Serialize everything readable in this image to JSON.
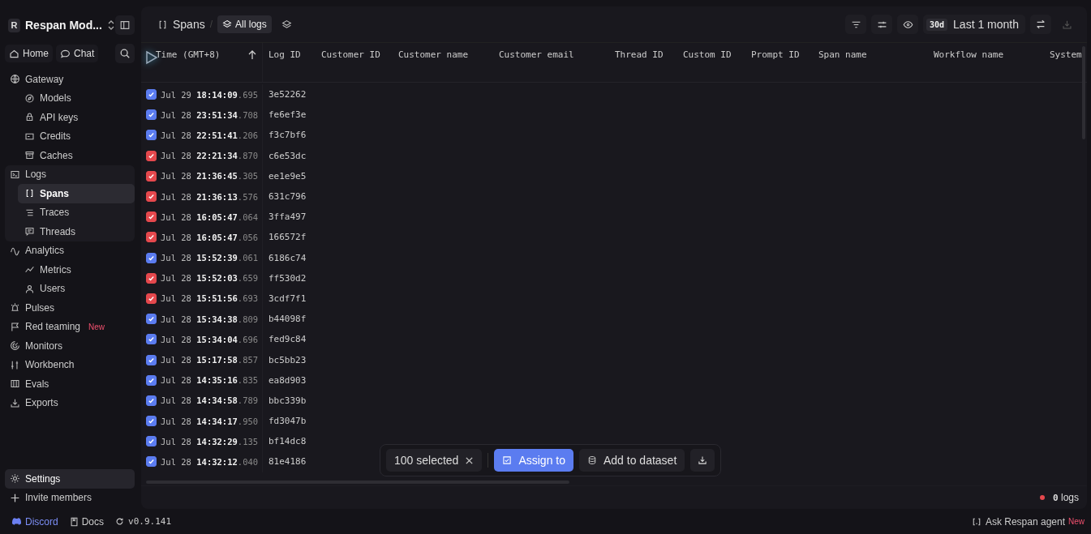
{
  "workspace": {
    "initial": "R",
    "name": "Respan Mod..."
  },
  "quick_links": [
    {
      "label": "Home"
    },
    {
      "label": "Chat"
    }
  ],
  "nav": [
    {
      "label": "Gateway",
      "selected": false,
      "children": [
        {
          "label": "Models",
          "selected": false
        },
        {
          "label": "API keys",
          "selected": false
        },
        {
          "label": "Credits",
          "selected": false
        },
        {
          "label": "Caches",
          "selected": false
        }
      ]
    },
    {
      "label": "Logs",
      "selected": false,
      "children": [
        {
          "label": "Spans",
          "selected": true
        },
        {
          "label": "Traces",
          "selected": false
        },
        {
          "label": "Threads",
          "selected": false
        }
      ]
    },
    {
      "label": "Analytics",
      "selected": false,
      "children": [
        {
          "label": "Metrics",
          "selected": false
        },
        {
          "label": "Users",
          "selected": false
        }
      ]
    },
    {
      "label": "Pulses",
      "selected": false
    },
    {
      "label": "Red teaming",
      "selected": false,
      "badge": "New"
    },
    {
      "label": "Monitors",
      "selected": false
    },
    {
      "label": "Workbench",
      "selected": false
    },
    {
      "label": "Evals",
      "selected": false
    },
    {
      "label": "Exports",
      "selected": false
    }
  ],
  "bottom_nav": [
    {
      "label": "Settings",
      "selected": true
    },
    {
      "label": "Invite members",
      "selected": false
    }
  ],
  "footer": {
    "links": [
      {
        "label": "Discord"
      },
      {
        "label": "Docs"
      }
    ],
    "version": "v0.9.141",
    "agent": "Ask Respan agent",
    "agent_badge": "New"
  },
  "breadcrumb": {
    "page": "Spans",
    "separator": "/",
    "view": "All logs"
  },
  "toolbar": {
    "range_badge": "30d",
    "range": "Last 1 month"
  },
  "table": {
    "columns": [
      "Time (GMT+8)",
      "Log ID",
      "Customer ID",
      "Customer name",
      "Customer email",
      "Thread ID",
      "Custom ID",
      "Prompt ID",
      "Span name",
      "Workflow name",
      "System"
    ],
    "rows": [
      {
        "checked": true,
        "color": "#5b7cf0",
        "date": "Jul 29",
        "time": "18:14:09",
        "ms": ".695",
        "log_id": "3e52262"
      },
      {
        "checked": true,
        "color": "#5b7cf0",
        "date": "Jul 28",
        "time": "23:51:34",
        "ms": ".708",
        "log_id": "fe6ef3e"
      },
      {
        "checked": true,
        "color": "#5b7cf0",
        "date": "Jul 28",
        "time": "22:51:41",
        "ms": ".206",
        "log_id": "f3c7bf6"
      },
      {
        "checked": true,
        "color": "#e5484d",
        "date": "Jul 28",
        "time": "22:21:34",
        "ms": ".870",
        "log_id": "c6e53dc"
      },
      {
        "checked": true,
        "color": "#e5484d",
        "date": "Jul 28",
        "time": "21:36:45",
        "ms": ".305",
        "log_id": "ee1e9e5"
      },
      {
        "checked": true,
        "color": "#e5484d",
        "date": "Jul 28",
        "time": "21:36:13",
        "ms": ".576",
        "log_id": "631c796"
      },
      {
        "checked": true,
        "color": "#e5484d",
        "date": "Jul 28",
        "time": "16:05:47",
        "ms": ".064",
        "log_id": "3ffa497"
      },
      {
        "checked": true,
        "color": "#e5484d",
        "date": "Jul 28",
        "time": "16:05:47",
        "ms": ".056",
        "log_id": "166572f"
      },
      {
        "checked": true,
        "color": "#5b7cf0",
        "date": "Jul 28",
        "time": "15:52:39",
        "ms": ".061",
        "log_id": "6186c74"
      },
      {
        "checked": true,
        "color": "#e5484d",
        "date": "Jul 28",
        "time": "15:52:03",
        "ms": ".659",
        "log_id": "ff530d2"
      },
      {
        "checked": true,
        "color": "#e5484d",
        "date": "Jul 28",
        "time": "15:51:56",
        "ms": ".693",
        "log_id": "3cdf7f1"
      },
      {
        "checked": true,
        "color": "#5b7cf0",
        "date": "Jul 28",
        "time": "15:34:38",
        "ms": ".809",
        "log_id": "b44098f"
      },
      {
        "checked": true,
        "color": "#5b7cf0",
        "date": "Jul 28",
        "time": "15:34:04",
        "ms": ".696",
        "log_id": "fed9c84"
      },
      {
        "checked": true,
        "color": "#5b7cf0",
        "date": "Jul 28",
        "time": "15:17:58",
        "ms": ".857",
        "log_id": "bc5bb23"
      },
      {
        "checked": true,
        "color": "#5b7cf0",
        "date": "Jul 28",
        "time": "14:35:16",
        "ms": ".835",
        "log_id": "ea8d903"
      },
      {
        "checked": true,
        "color": "#5b7cf0",
        "date": "Jul 28",
        "time": "14:34:58",
        "ms": ".789",
        "log_id": "bbc339b"
      },
      {
        "checked": true,
        "color": "#5b7cf0",
        "date": "Jul 28",
        "time": "14:34:17",
        "ms": ".950",
        "log_id": "fd3047b"
      },
      {
        "checked": true,
        "color": "#5b7cf0",
        "date": "Jul 28",
        "time": "14:32:29",
        "ms": ".135",
        "log_id": "bf14dc8"
      },
      {
        "checked": true,
        "color": "#5b7cf0",
        "date": "Jul 28",
        "time": "14:32:12",
        "ms": ".040",
        "log_id": "81e4186"
      }
    ]
  },
  "selection_bar": {
    "count": "100 selected",
    "assign": "Assign to",
    "dataset": "Add to dataset"
  },
  "status": {
    "count": "0",
    "unit": "logs"
  }
}
